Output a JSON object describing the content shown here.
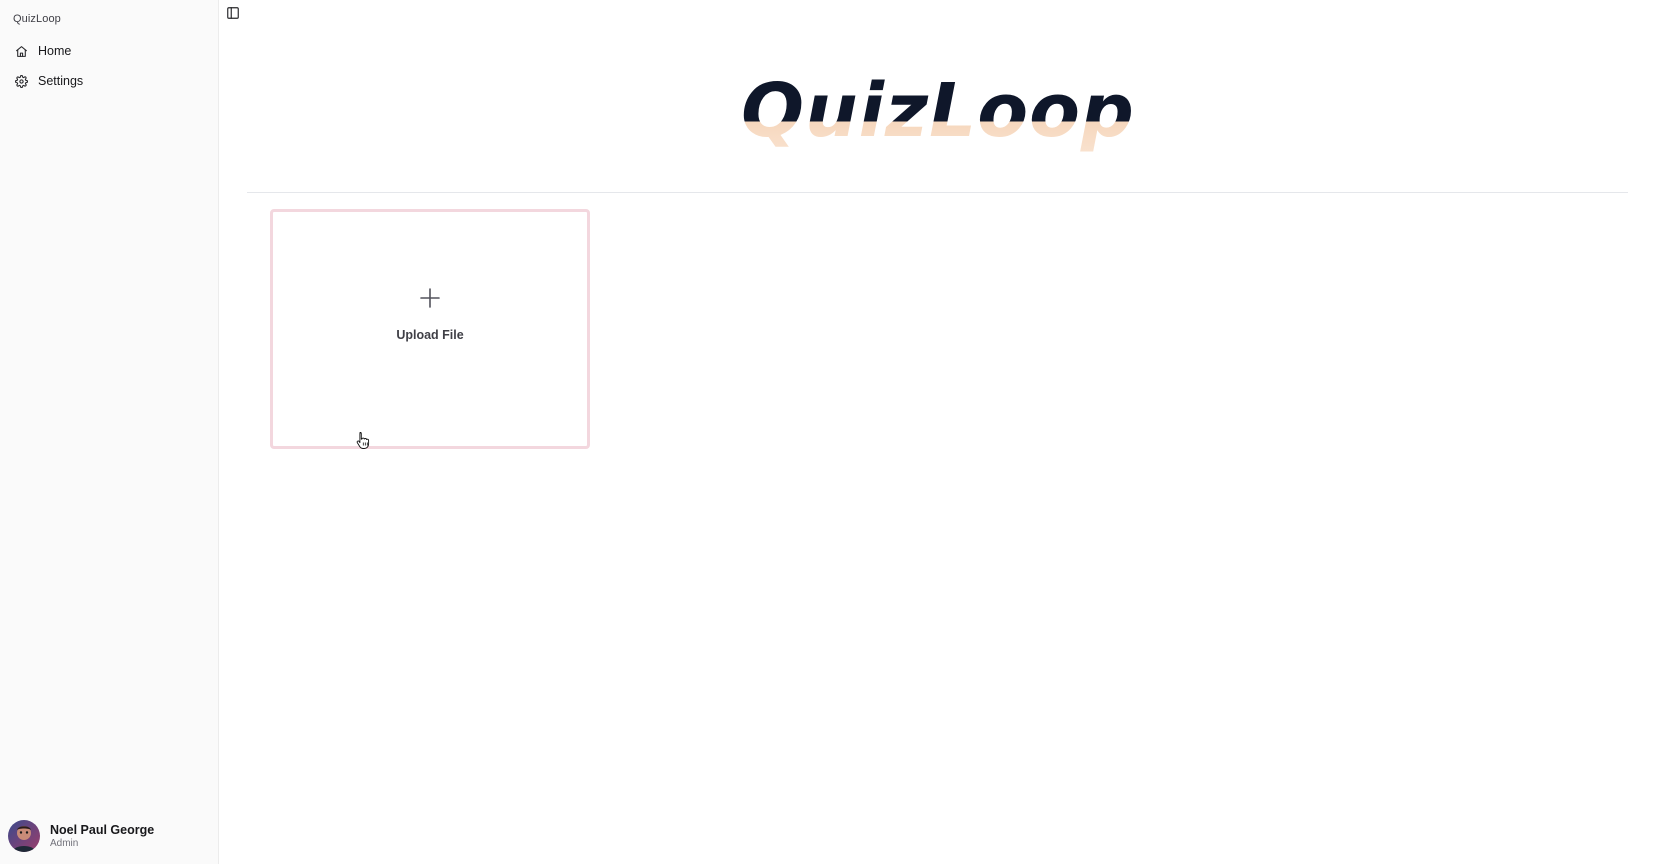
{
  "app": {
    "brand": "QuizLoop"
  },
  "sidebar": {
    "items": [
      {
        "label": "Home",
        "icon": "home-icon"
      },
      {
        "label": "Settings",
        "icon": "gear-icon"
      }
    ],
    "user": {
      "name": "Noel Paul George",
      "role": "Admin"
    }
  },
  "main": {
    "logo_text": "QuizLoop",
    "upload": {
      "label": "Upload File",
      "icon": "plus-icon"
    }
  },
  "colors": {
    "sidebar_bg": "#fafafa",
    "logo_dark": "#0f172a",
    "logo_accent": "#f6d7bd",
    "card_border": "#f3d7de"
  }
}
